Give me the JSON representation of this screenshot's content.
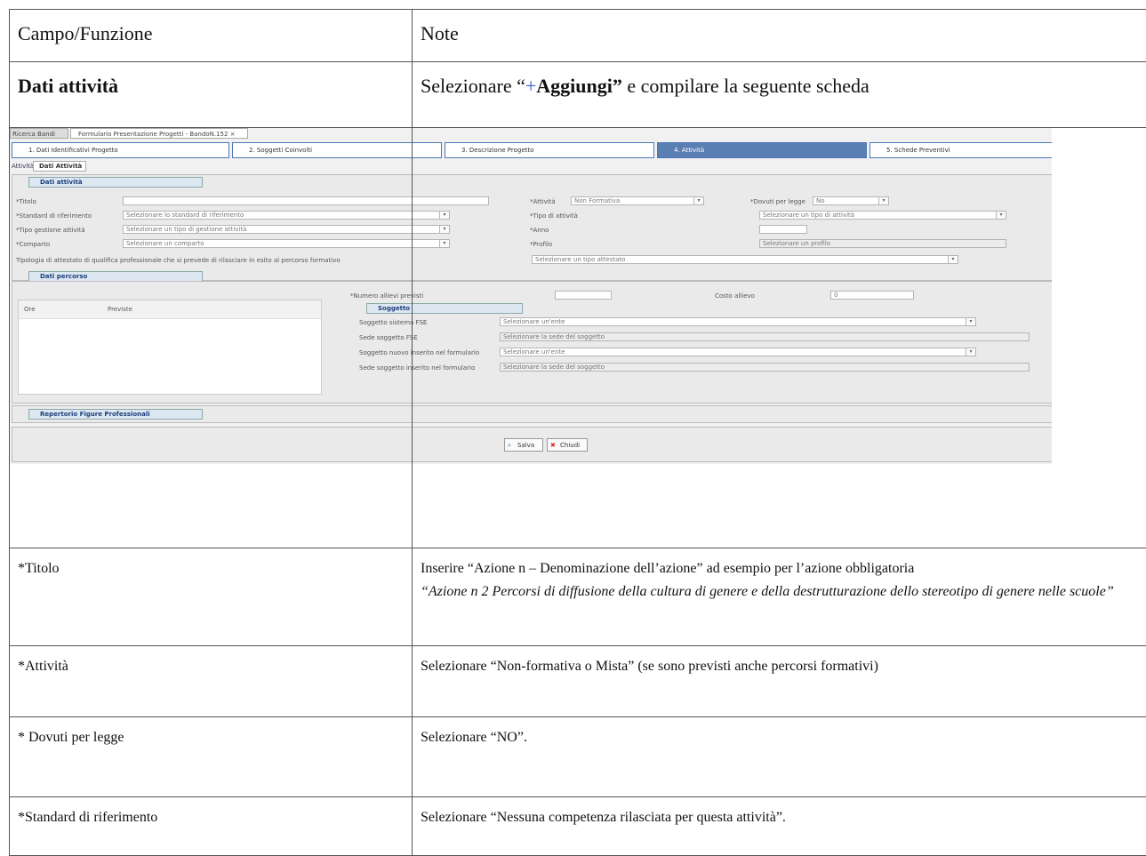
{
  "table": {
    "header": {
      "col1": "Campo/Funzione",
      "col2": "Note"
    },
    "section": {
      "name": "Dati attività",
      "note_pre": "Selezionare “",
      "note_plus": "+",
      "note_bold": "Aggiungi”",
      "note_post": " e compilare la seguente scheda"
    },
    "rows": [
      {
        "field": "*Titolo",
        "note": "Inserire  “Azione n    – Denominazione dell’azione” ad esempio per l’azione obbligatoria",
        "note_italic": "“Azione n 2  Percorsi di diffusione della cultura di genere e della destrutturazione dello stereotipo di genere nelle scuole”"
      },
      {
        "field": "*Attività",
        "note": "Selezionare “Non-formativa o Mista” (se sono previsti anche percorsi formativi)"
      },
      {
        "field": "* Dovuti per legge",
        "note": "Selezionare “NO”."
      },
      {
        "field": "*Standard di riferimento",
        "note": "Selezionare “Nessuna competenza rilasciata per questa attività”."
      }
    ]
  },
  "screenshot": {
    "top_tabs": [
      "Ricerca Bandi",
      "Formulario Presentazione Progetti - BandoN.152  ×"
    ],
    "wizard_steps": [
      "1. Dati Identificativi Progetto",
      "2. Soggetti Coinvolti",
      "3. Descrizione Progetto",
      "4. Attività",
      "5. Schede Preventivi"
    ],
    "subtabs": [
      "Attività",
      "Dati Attività  ×"
    ],
    "panel_dati_attivita": {
      "title": "Dati attività",
      "titolo_label": "*Titolo",
      "attivita_label": "*Attività",
      "attivita_value": "Non Formativa",
      "dovuti_label": "*Dovuti per legge",
      "dovuti_value": "No",
      "standard_label": "*Standard di riferimento",
      "standard_value": "Selezionare lo standard di riferimento",
      "tipo_attivita_label": "*Tipo di attività",
      "tipo_attivita_value": "Selezionare un tipo di attività",
      "tipo_gestione_label": "*Tipo gestione attività",
      "tipo_gestione_value": "Selezionare un tipo di gestione attività",
      "anno_label": "*Anno",
      "comparto_label": "*Comparto",
      "comparto_value": "Selezionare un comparto",
      "profilo_label": "*Profilo",
      "profilo_value": "Selezionare un profilo",
      "attestato_label": "Tipologia di attestato di qualifica professionale che si prevede di rilasciare in esito al percorso formativo",
      "attestato_value": "Selezionare un tipo attestato"
    },
    "panel_dati_percorso": {
      "title": "Dati percorso",
      "col_ore": "Ore",
      "col_previste": "Previste",
      "numero_allievi_label": "*Numero allievi previsti",
      "costo_allievo_label": "Costo allievo",
      "costo_allievo_value": "0",
      "soggetto_title": "Soggetto",
      "soggetto_fse_label": "Soggetto sistema FSE",
      "soggetto_fse_value": "Selezionare un'ente",
      "sede_fse_label": "Sede soggetto FSE",
      "sede_fse_value": "Selezionare la sede del soggetto",
      "soggetto_nuovo_label": "Soggetto nuovo inserito nel formulario",
      "soggetto_nuovo_value": "Selezionare un'ente",
      "sede_nuovo_label": "Sede soggetto inserito nel formulario",
      "sede_nuovo_value": "Selezionare la sede del soggetto"
    },
    "panel_repertorio": {
      "title": "Repertorio Figure Professionali"
    },
    "buttons": {
      "salva": "Salva",
      "chiudi": "Chiudi"
    },
    "colors": {
      "accent": "#5a7fb3",
      "panel_title": "#1c3f7c",
      "plus": "#2a5fd6"
    },
    "icons": [
      "search-icon",
      "close-icon",
      "dropdown-arrow-icon"
    ]
  }
}
